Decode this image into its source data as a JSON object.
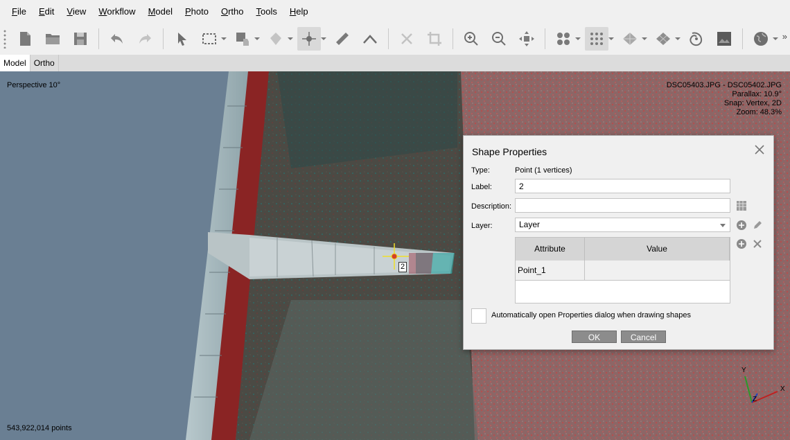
{
  "menu": {
    "items": [
      {
        "first": "F",
        "rest": "ile"
      },
      {
        "first": "E",
        "rest": "dit"
      },
      {
        "first": "V",
        "rest": "iew"
      },
      {
        "first": "W",
        "rest": "orkflow"
      },
      {
        "first": "M",
        "rest": "odel"
      },
      {
        "first": "P",
        "rest": "hoto"
      },
      {
        "first": "O",
        "rest": "rtho"
      },
      {
        "first": "T",
        "rest": "ools"
      },
      {
        "first": "H",
        "rest": "elp"
      }
    ]
  },
  "toolbar": {
    "icons": [
      "new-file-icon",
      "open-folder-icon",
      "save-icon",
      "undo-icon",
      "redo-icon",
      "navigation-arrow-icon",
      "rectangle-selection-icon",
      "draw-polygon-icon",
      "shape-fill-icon",
      "draw-point-icon",
      "ruler-icon",
      "polyline-icon",
      "delete-icon",
      "crop-icon",
      "zoom-in-icon",
      "zoom-out-icon",
      "reset-view-icon",
      "tie-points-icon",
      "point-cloud-icon",
      "mesh-icon",
      "tiled-model-icon",
      "dem-icon",
      "ortho-icon",
      "globe-icon"
    ],
    "more_label": "»"
  },
  "tabs": [
    {
      "label": "Model",
      "active": true
    },
    {
      "label": "Ortho",
      "active": false
    }
  ],
  "viewport": {
    "view_mode": "Perspective 10°",
    "image_pair": "DSC05403.JPG - DSC05402.JPG",
    "parallax": "Parallax: 10.9°",
    "snap": "Snap: Vertex, 2D",
    "zoom": "Zoom: 48.3%",
    "points_count": "543,922,014 points",
    "marker_label": "2",
    "axes": {
      "x": "X",
      "y": "Y",
      "z": "Z"
    }
  },
  "dialog": {
    "title": "Shape Properties",
    "type_label": "Type:",
    "type_value": "Point (1 vertices)",
    "label_label": "Label:",
    "label_value": "2",
    "description_label": "Description:",
    "description_value": "",
    "layer_label": "Layer:",
    "layer_value": "Layer",
    "table": {
      "headers": [
        "Attribute",
        "Value"
      ],
      "rows": [
        [
          "Point_1",
          ""
        ]
      ]
    },
    "auto_open_label": "Automatically open Properties dialog when drawing shapes",
    "auto_open_checked": false,
    "ok_label": "OK",
    "cancel_label": "Cancel"
  },
  "colors": {
    "sky": "#6a7f93",
    "terrain": "#8a5a5a",
    "dialog_bg": "#f0f0f0",
    "button_bg": "#8c8c8c"
  }
}
